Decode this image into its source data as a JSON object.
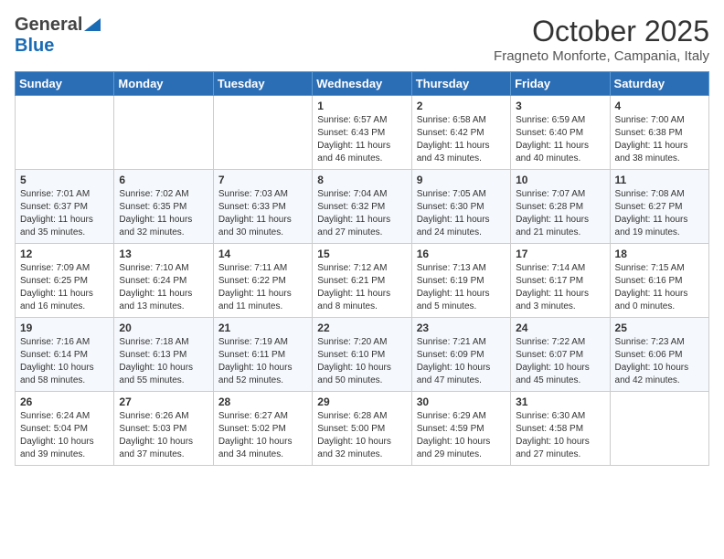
{
  "header": {
    "logo_general": "General",
    "logo_blue": "Blue",
    "month": "October 2025",
    "location": "Fragneto Monforte, Campania, Italy"
  },
  "weekdays": [
    "Sunday",
    "Monday",
    "Tuesday",
    "Wednesday",
    "Thursday",
    "Friday",
    "Saturday"
  ],
  "weeks": [
    [
      {
        "day": "",
        "info": ""
      },
      {
        "day": "",
        "info": ""
      },
      {
        "day": "",
        "info": ""
      },
      {
        "day": "1",
        "info": "Sunrise: 6:57 AM\nSunset: 6:43 PM\nDaylight: 11 hours\nand 46 minutes."
      },
      {
        "day": "2",
        "info": "Sunrise: 6:58 AM\nSunset: 6:42 PM\nDaylight: 11 hours\nand 43 minutes."
      },
      {
        "day": "3",
        "info": "Sunrise: 6:59 AM\nSunset: 6:40 PM\nDaylight: 11 hours\nand 40 minutes."
      },
      {
        "day": "4",
        "info": "Sunrise: 7:00 AM\nSunset: 6:38 PM\nDaylight: 11 hours\nand 38 minutes."
      }
    ],
    [
      {
        "day": "5",
        "info": "Sunrise: 7:01 AM\nSunset: 6:37 PM\nDaylight: 11 hours\nand 35 minutes."
      },
      {
        "day": "6",
        "info": "Sunrise: 7:02 AM\nSunset: 6:35 PM\nDaylight: 11 hours\nand 32 minutes."
      },
      {
        "day": "7",
        "info": "Sunrise: 7:03 AM\nSunset: 6:33 PM\nDaylight: 11 hours\nand 30 minutes."
      },
      {
        "day": "8",
        "info": "Sunrise: 7:04 AM\nSunset: 6:32 PM\nDaylight: 11 hours\nand 27 minutes."
      },
      {
        "day": "9",
        "info": "Sunrise: 7:05 AM\nSunset: 6:30 PM\nDaylight: 11 hours\nand 24 minutes."
      },
      {
        "day": "10",
        "info": "Sunrise: 7:07 AM\nSunset: 6:28 PM\nDaylight: 11 hours\nand 21 minutes."
      },
      {
        "day": "11",
        "info": "Sunrise: 7:08 AM\nSunset: 6:27 PM\nDaylight: 11 hours\nand 19 minutes."
      }
    ],
    [
      {
        "day": "12",
        "info": "Sunrise: 7:09 AM\nSunset: 6:25 PM\nDaylight: 11 hours\nand 16 minutes."
      },
      {
        "day": "13",
        "info": "Sunrise: 7:10 AM\nSunset: 6:24 PM\nDaylight: 11 hours\nand 13 minutes."
      },
      {
        "day": "14",
        "info": "Sunrise: 7:11 AM\nSunset: 6:22 PM\nDaylight: 11 hours\nand 11 minutes."
      },
      {
        "day": "15",
        "info": "Sunrise: 7:12 AM\nSunset: 6:21 PM\nDaylight: 11 hours\nand 8 minutes."
      },
      {
        "day": "16",
        "info": "Sunrise: 7:13 AM\nSunset: 6:19 PM\nDaylight: 11 hours\nand 5 minutes."
      },
      {
        "day": "17",
        "info": "Sunrise: 7:14 AM\nSunset: 6:17 PM\nDaylight: 11 hours\nand 3 minutes."
      },
      {
        "day": "18",
        "info": "Sunrise: 7:15 AM\nSunset: 6:16 PM\nDaylight: 11 hours\nand 0 minutes."
      }
    ],
    [
      {
        "day": "19",
        "info": "Sunrise: 7:16 AM\nSunset: 6:14 PM\nDaylight: 10 hours\nand 58 minutes."
      },
      {
        "day": "20",
        "info": "Sunrise: 7:18 AM\nSunset: 6:13 PM\nDaylight: 10 hours\nand 55 minutes."
      },
      {
        "day": "21",
        "info": "Sunrise: 7:19 AM\nSunset: 6:11 PM\nDaylight: 10 hours\nand 52 minutes."
      },
      {
        "day": "22",
        "info": "Sunrise: 7:20 AM\nSunset: 6:10 PM\nDaylight: 10 hours\nand 50 minutes."
      },
      {
        "day": "23",
        "info": "Sunrise: 7:21 AM\nSunset: 6:09 PM\nDaylight: 10 hours\nand 47 minutes."
      },
      {
        "day": "24",
        "info": "Sunrise: 7:22 AM\nSunset: 6:07 PM\nDaylight: 10 hours\nand 45 minutes."
      },
      {
        "day": "25",
        "info": "Sunrise: 7:23 AM\nSunset: 6:06 PM\nDaylight: 10 hours\nand 42 minutes."
      }
    ],
    [
      {
        "day": "26",
        "info": "Sunrise: 6:24 AM\nSunset: 5:04 PM\nDaylight: 10 hours\nand 39 minutes."
      },
      {
        "day": "27",
        "info": "Sunrise: 6:26 AM\nSunset: 5:03 PM\nDaylight: 10 hours\nand 37 minutes."
      },
      {
        "day": "28",
        "info": "Sunrise: 6:27 AM\nSunset: 5:02 PM\nDaylight: 10 hours\nand 34 minutes."
      },
      {
        "day": "29",
        "info": "Sunrise: 6:28 AM\nSunset: 5:00 PM\nDaylight: 10 hours\nand 32 minutes."
      },
      {
        "day": "30",
        "info": "Sunrise: 6:29 AM\nSunset: 4:59 PM\nDaylight: 10 hours\nand 29 minutes."
      },
      {
        "day": "31",
        "info": "Sunrise: 6:30 AM\nSunset: 4:58 PM\nDaylight: 10 hours\nand 27 minutes."
      },
      {
        "day": "",
        "info": ""
      }
    ]
  ]
}
